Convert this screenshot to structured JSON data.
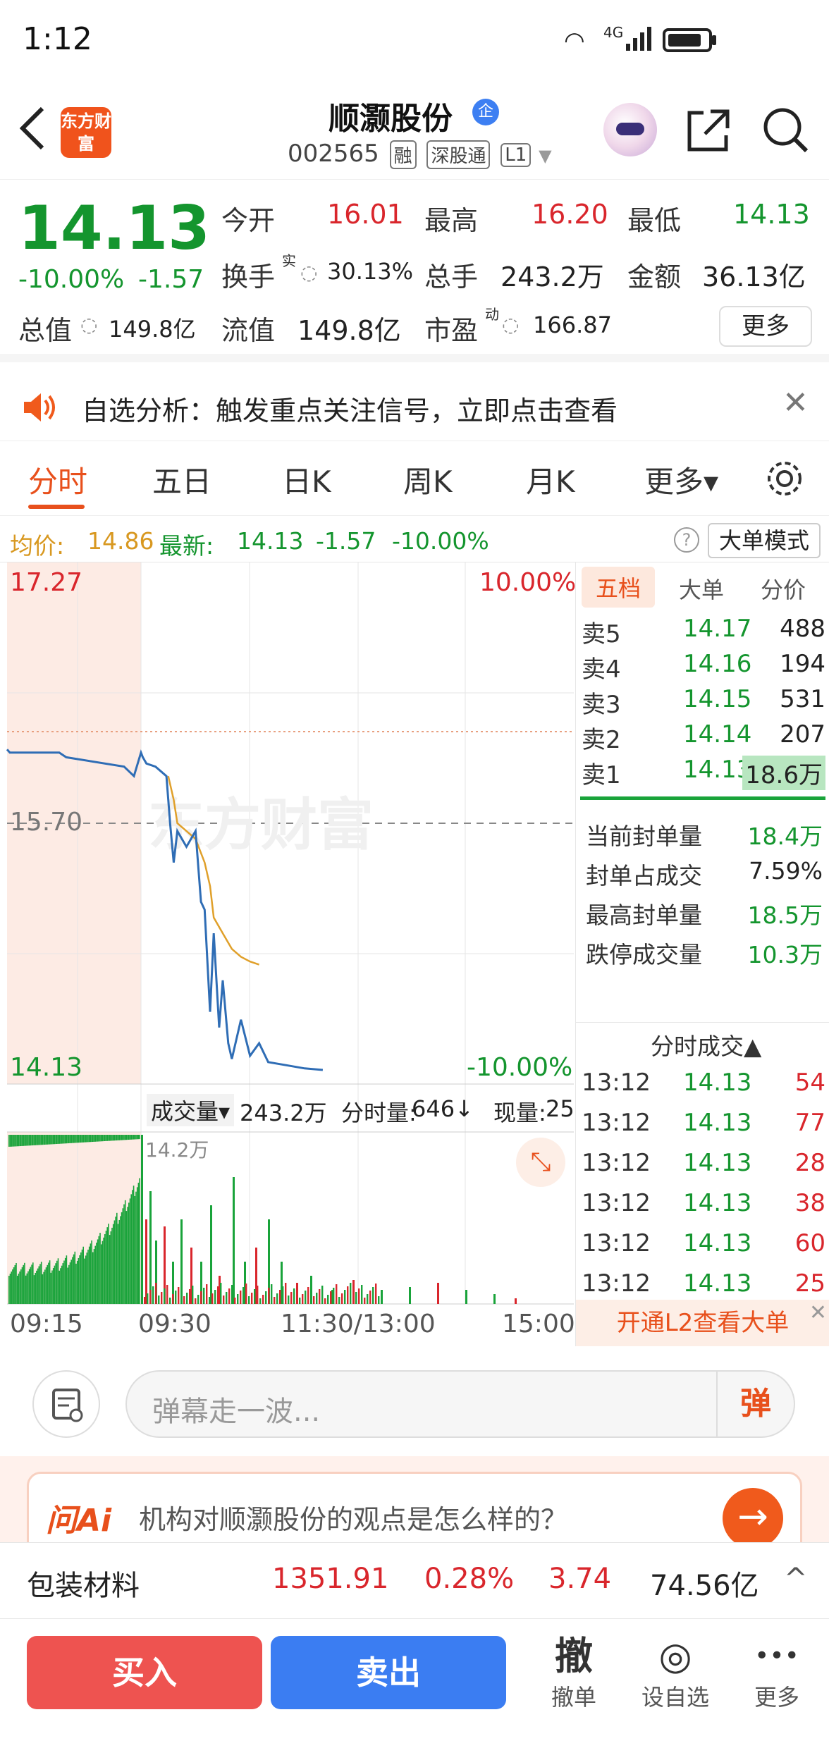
{
  "status_bar": {
    "time": "1:12",
    "network": "4G"
  },
  "header": {
    "logo_text": "东方财富",
    "stock_name": "顺灏股份",
    "verified_badge": "企",
    "stock_code": "002565",
    "tags": [
      "融",
      "深股通",
      "L1"
    ]
  },
  "quote": {
    "price": "14.13",
    "change_pct": "-10.00%",
    "change": "-1.57",
    "fields": {
      "open_label": "今开",
      "open": "16.01",
      "high_label": "最高",
      "high": "16.20",
      "low_label": "最低",
      "low": "14.13",
      "turnover_label": "换手",
      "turnover_sup": "实",
      "turnover": "30.13%",
      "volume_label": "总手",
      "volume": "243.2万",
      "amount_label": "金额",
      "amount": "36.13亿",
      "mktcap_label": "总值",
      "mktcap": "149.8亿",
      "float_label": "流值",
      "float": "149.8亿",
      "pe_label": "市盈",
      "pe_sup": "动",
      "pe": "166.87"
    },
    "more_label": "更多"
  },
  "banner": {
    "text": "自选分析：触发重点关注信号，立即点击查看"
  },
  "tabs": [
    "分时",
    "五日",
    "日K",
    "周K",
    "月K",
    "更多▾"
  ],
  "info_row": {
    "avg_label": "均价:",
    "avg": "14.86",
    "latest_label": "最新:",
    "latest": "14.13",
    "change": "-1.57",
    "change_pct": "-10.00%",
    "big_order_mode": "大单模式"
  },
  "chart_data": {
    "type": "line",
    "x_labels": [
      "09:15",
      "09:30",
      "11:30/13:00",
      "15:00"
    ],
    "y_top_label": "17.27",
    "y_mid_label": "15.70",
    "y_bottom_label": "14.13",
    "pct_top_label": "10.00%",
    "pct_bottom_label": "-10.00%",
    "ylim": [
      14.13,
      17.27
    ],
    "prev_close": 15.7,
    "series": [
      {
        "name": "price",
        "color": "#2f6db5",
        "x": [
          0,
          1,
          3,
          8,
          14,
          15,
          16,
          18,
          20,
          25,
          30,
          33,
          35,
          38,
          40,
          43,
          45,
          48,
          50,
          55,
          60,
          65,
          70,
          80,
          90,
          100
        ],
        "y": [
          16.15,
          16.12,
          16.08,
          16.06,
          16.0,
          15.85,
          15.7,
          15.45,
          15.65,
          15.55,
          15.65,
          15.2,
          15.15,
          14.5,
          15.0,
          14.4,
          14.7,
          14.3,
          14.2,
          14.45,
          14.22,
          14.3,
          14.18,
          14.16,
          14.14,
          14.13
        ]
      },
      {
        "name": "avg",
        "color": "#e0a02a",
        "x": [
          15,
          18,
          20,
          25,
          30,
          35,
          38,
          40,
          45,
          50,
          55,
          60,
          65
        ],
        "y": [
          16.0,
          15.85,
          15.7,
          15.65,
          15.6,
          15.45,
          15.3,
          15.1,
          15.0,
          14.9,
          14.85,
          14.82,
          14.8
        ]
      }
    ]
  },
  "volume_bar": {
    "label": "成交量▾",
    "total": "243.2万",
    "tick_label": "分时量:",
    "tick_value": "646↓",
    "now_label": "现量:",
    "now_value": "25",
    "max_label": "14.2万"
  },
  "order_book": {
    "tabs": [
      "五档",
      "大单",
      "分价"
    ],
    "asks": [
      {
        "label": "卖5",
        "price": "14.17",
        "vol": "488"
      },
      {
        "label": "卖4",
        "price": "14.16",
        "vol": "194"
      },
      {
        "label": "卖3",
        "price": "14.15",
        "vol": "531"
      },
      {
        "label": "卖2",
        "price": "14.14",
        "vol": "207"
      },
      {
        "label": "卖1",
        "price": "14.13",
        "vol": "18.6万"
      }
    ],
    "stats": [
      {
        "label": "当前封单量",
        "value": "18.4万"
      },
      {
        "label": "封单占成交",
        "value": "7.59%"
      },
      {
        "label": "最高封单量",
        "value": "18.5万"
      },
      {
        "label": "跌停成交量",
        "value": "10.3万"
      }
    ],
    "ticks_title": "分时成交▲",
    "ticks": [
      {
        "time": "13:12",
        "price": "14.13",
        "vol": "54"
      },
      {
        "time": "13:12",
        "price": "14.13",
        "vol": "77"
      },
      {
        "time": "13:12",
        "price": "14.13",
        "vol": "28"
      },
      {
        "time": "13:12",
        "price": "14.13",
        "vol": "38"
      },
      {
        "time": "13:12",
        "price": "14.13",
        "vol": "60"
      },
      {
        "time": "13:12",
        "price": "14.13",
        "vol": "25"
      }
    ],
    "l2_label": "开通L2查看大单"
  },
  "danmu": {
    "placeholder": "弹幕走一波...",
    "button": "弹"
  },
  "ai": {
    "logo": "问Ai",
    "question": "机构对顺灏股份的观点是怎么样的？",
    "arrow": "→"
  },
  "sector": {
    "name": "包装材料",
    "value": "1351.91",
    "pct": "0.28%",
    "change": "3.74",
    "amount": "74.56亿",
    "chevron": "^"
  },
  "bottom": {
    "buy": "买入",
    "sell": "卖出",
    "items": [
      {
        "icon": "撤",
        "label": "撤单"
      },
      {
        "icon": "◎",
        "label": "设自选"
      },
      {
        "icon": "•••",
        "label": "更多"
      }
    ]
  },
  "colors": {
    "up": "#d9262c",
    "down": "#14952e",
    "accent": "#e8501c"
  }
}
